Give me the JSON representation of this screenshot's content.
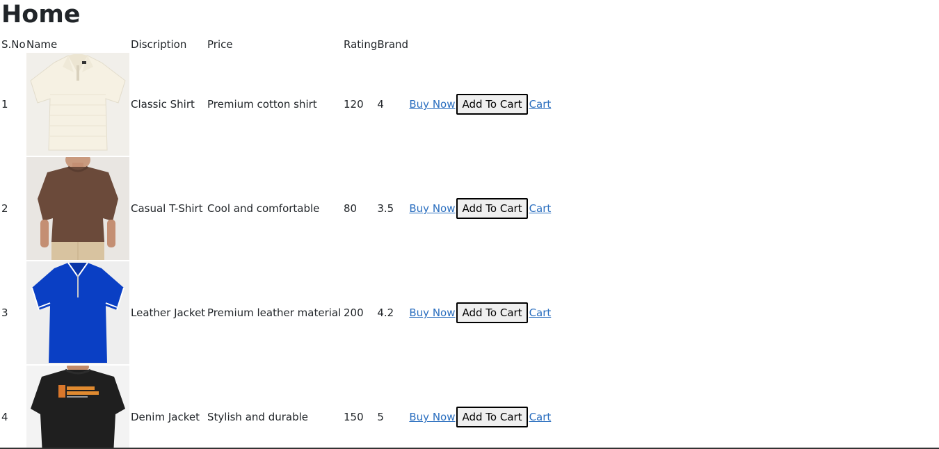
{
  "page": {
    "title": "Home"
  },
  "table": {
    "headers": [
      "S.No",
      "Name",
      "Discription",
      "Price",
      "Rating",
      "Brand"
    ],
    "action_labels": {
      "buy_now": "Buy Now",
      "add_to_cart": "Add To Cart",
      "cart": "Cart"
    },
    "rows": [
      {
        "sno": "1",
        "name": "Classic Shirt",
        "description": "Premium cotton shirt",
        "price": "120",
        "rating": "4",
        "image": "cream-knit-polo-shirt"
      },
      {
        "sno": "2",
        "name": "Casual T-Shirt",
        "description": "Cool and comfortable",
        "price": "80",
        "rating": "3.5",
        "image": "brown-oversized-tshirt"
      },
      {
        "sno": "3",
        "name": "Leather Jacket",
        "description": "Premium leather material",
        "price": "200",
        "rating": "4.2",
        "image": "blue-zip-polo-shirt"
      },
      {
        "sno": "4",
        "name": "Denim Jacket",
        "description": "Stylish and durable",
        "price": "150",
        "rating": "5",
        "image": "black-printed-tshirt"
      }
    ]
  },
  "colors": {
    "link": "#2a6ebf",
    "text": "#212529",
    "button_bg": "#efefef"
  }
}
